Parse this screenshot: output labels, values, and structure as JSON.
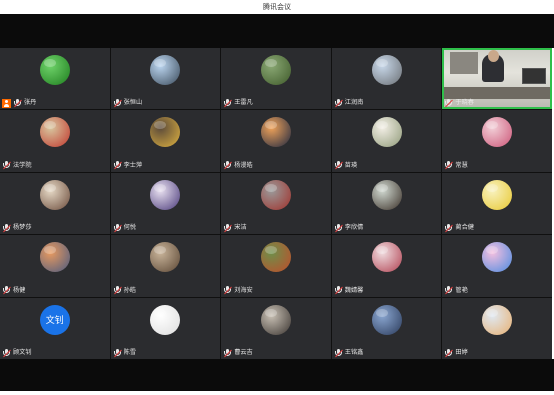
{
  "window": {
    "title": "腾讯会议"
  },
  "participants": [
    {
      "name": "张丹",
      "badge": "host",
      "avatar_colors": [
        "#6fd36a",
        "#1e7d1e"
      ]
    },
    {
      "name": "张恒山",
      "avatar_colors": [
        "#bcd6f0",
        "#3a4a5a"
      ]
    },
    {
      "name": "王雷凡",
      "avatar_colors": [
        "#8aa874",
        "#3f5a2a"
      ]
    },
    {
      "name": "江润南",
      "avatar_colors": [
        "#c8d8ea",
        "#6b6f73"
      ]
    },
    {
      "name": "于晓春",
      "video": true
    },
    {
      "name": "法学院",
      "avatar_colors": [
        "#d8c7a0",
        "#c1382d"
      ]
    },
    {
      "name": "李士萍",
      "avatar_colors": [
        "#5b4a3a",
        "#e0b340"
      ]
    },
    {
      "name": "杨漫皓",
      "avatar_colors": [
        "#f0a35a",
        "#1e2740"
      ]
    },
    {
      "name": "苗瑛",
      "avatar_colors": [
        "#f3efe6",
        "#8f9a78"
      ]
    },
    {
      "name": "常慧",
      "avatar_colors": [
        "#f2d0d8",
        "#cc5577"
      ]
    },
    {
      "name": "杨梦莎",
      "avatar_colors": [
        "#e6d9c6",
        "#6a4a3a"
      ]
    },
    {
      "name": "何悦",
      "avatar_colors": [
        "#e8e0f0",
        "#4a3a7a"
      ]
    },
    {
      "name": "宋洁",
      "avatar_colors": [
        "#9a9a9a",
        "#a0302a"
      ]
    },
    {
      "name": "李欣倩",
      "avatar_colors": [
        "#d0d8d0",
        "#3a3028"
      ]
    },
    {
      "name": "蔺合健",
      "avatar_colors": [
        "#f8f2c0",
        "#e8c830"
      ]
    },
    {
      "name": "杨健",
      "avatar_colors": [
        "#e89a60",
        "#4a5a80"
      ]
    },
    {
      "name": "孙皓",
      "avatar_colors": [
        "#c9b49a",
        "#5a4634"
      ]
    },
    {
      "name": "刘海安",
      "avatar_colors": [
        "#6e8f4a",
        "#c04c2a"
      ]
    },
    {
      "name": "魏婧馨",
      "avatar_colors": [
        "#f0dde0",
        "#b04050"
      ]
    },
    {
      "name": "管艳",
      "avatar_colors": [
        "#f5c0e0",
        "#4a8ae0"
      ]
    },
    {
      "name": "顾文钊",
      "avatar_text": "文钊",
      "avatar_colors": [
        "#1a73e8",
        "#1a73e8"
      ]
    },
    {
      "name": "陈雪",
      "avatar_colors": [
        "#ffffff",
        "#dddddd"
      ]
    },
    {
      "name": "曹云吉",
      "avatar_colors": [
        "#c8c0b4",
        "#3a3430"
      ]
    },
    {
      "name": "王铭鑫",
      "avatar_colors": [
        "#8aa6d0",
        "#2a3a5a"
      ]
    },
    {
      "name": "田婷",
      "avatar_colors": [
        "#dfe8f2",
        "#e8b070"
      ]
    }
  ]
}
